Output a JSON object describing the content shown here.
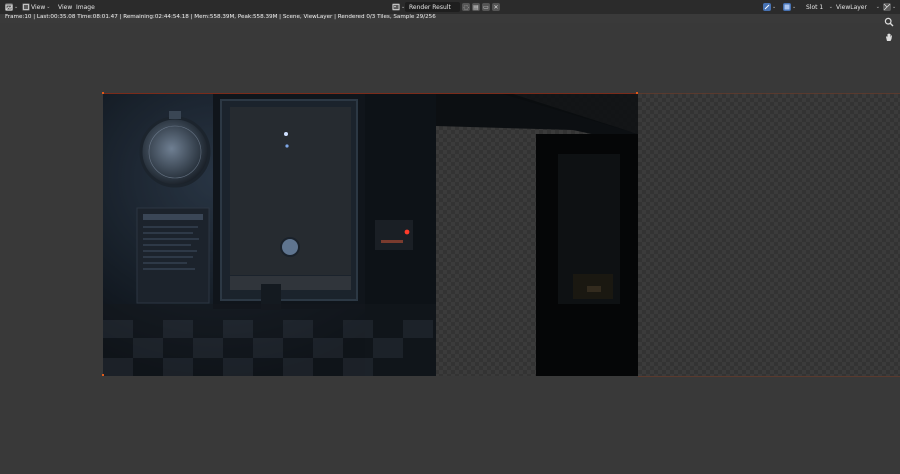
{
  "header": {
    "editor_icon": "image-editor-icon",
    "view_menu_1": "View",
    "view_menu_2": "View",
    "image_menu": "Image",
    "image_name": "Render Result",
    "slot": "Slot 1",
    "view_layer": "ViewLayer"
  },
  "status": {
    "text": "Frame:10 | Last:00:35.08 Time:08:01.47 | Remaining:02:44:54.18 | Mem:558.39M, Peak:558.39M | Scene, ViewLayer | Rendered 0/3 Tiles, Sample 29/256"
  },
  "tools": {
    "zoom": "zoom-icon",
    "pan": "hand-icon"
  },
  "colors": {
    "header_bg": "#2b2b2b",
    "viewport_bg": "#393939",
    "accent_blue": "#4772b3",
    "render_border": "#e05a1a"
  }
}
